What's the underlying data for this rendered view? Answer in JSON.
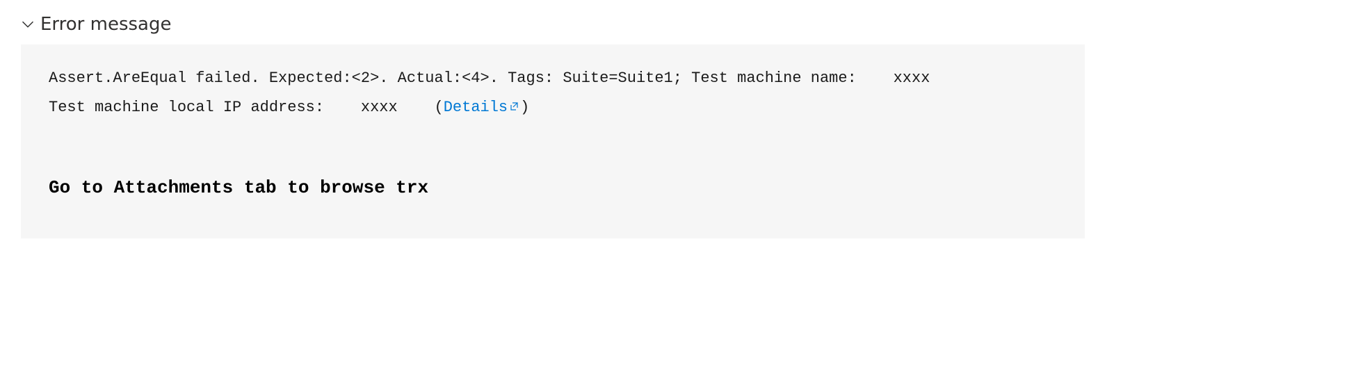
{
  "header": {
    "title": "Error message"
  },
  "error": {
    "line1_prefix": "Assert.AreEqual failed. Expected:<2>. Actual:<4>. Tags: Suite=Suite1; Test machine name:",
    "line1_redacted": "xxxx",
    "line2_prefix": "Test machine local IP address:",
    "line2_redacted": "xxxx",
    "details_label": "Details",
    "bold_instruction": "Go to Attachments tab to browse trx"
  }
}
